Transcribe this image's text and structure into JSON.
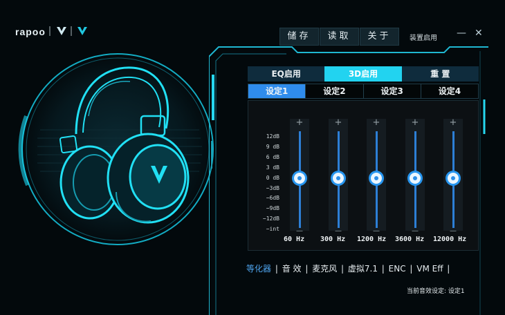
{
  "brand": {
    "name": "rapoo"
  },
  "top_buttons": {
    "save": "储存",
    "read": "读取",
    "about": "关于"
  },
  "device_label": "装置启用",
  "window": {
    "minimize": "—",
    "close": "✕"
  },
  "mode_tabs": [
    {
      "label": "EQ启用",
      "active": false
    },
    {
      "label": "3D启用",
      "active": true
    },
    {
      "label": "重 置",
      "active": false
    }
  ],
  "presets": [
    {
      "label": "设定1",
      "active": true
    },
    {
      "label": "设定2",
      "active": false
    },
    {
      "label": "设定3",
      "active": false
    },
    {
      "label": "设定4",
      "active": false
    }
  ],
  "db_scale": [
    "12dB",
    "9 dB",
    "6 dB",
    "3 dB",
    "0 dB",
    "−3dB",
    "−6dB",
    "−9dB",
    "−12dB",
    "−int"
  ],
  "eq_bands": [
    {
      "freq": "60 Hz",
      "gain_db": 0
    },
    {
      "freq": "300 Hz",
      "gain_db": 0
    },
    {
      "freq": "1200 Hz",
      "gain_db": 0
    },
    {
      "freq": "3600 Hz",
      "gain_db": 0
    },
    {
      "freq": "12000 Hz",
      "gain_db": 0
    }
  ],
  "bottom_tabs": [
    {
      "label": "等化器",
      "active": true
    },
    {
      "label": "音 效",
      "active": false
    },
    {
      "label": "麦克风",
      "active": false
    },
    {
      "label": "虚拟7.1",
      "active": false
    },
    {
      "label": "ENC",
      "active": false
    },
    {
      "label": "VM Eff",
      "active": false
    }
  ],
  "status_text": "当前音效设定: 设定1",
  "colors": {
    "accent": "#22d3f0",
    "selected": "#2f8cec",
    "background": "#03090c"
  }
}
